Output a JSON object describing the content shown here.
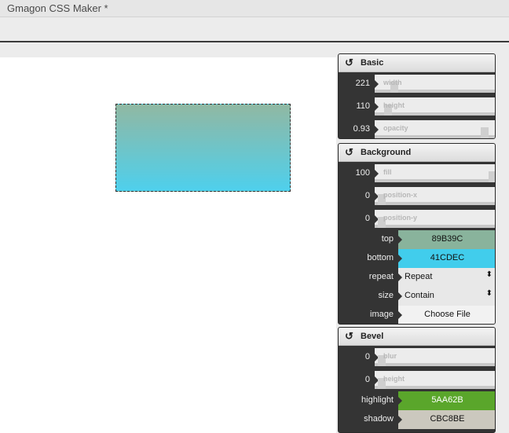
{
  "window": {
    "title": "Gmagon CSS Maker *"
  },
  "preview": {
    "top_color": "#89B39C",
    "bottom_color": "#41CDEC"
  },
  "basic": {
    "title": "Basic",
    "width": {
      "value": "221",
      "label": "width",
      "level": 0.11
    },
    "height": {
      "value": "110",
      "label": "height",
      "level": 0.06
    },
    "opacity": {
      "value": "0.93",
      "label": "opacity",
      "level": 0.93
    }
  },
  "background": {
    "title": "Background",
    "fill": {
      "value": "100",
      "label": "fill",
      "level": 1.0
    },
    "position_x": {
      "value": "0",
      "label": "position-x",
      "level": 0
    },
    "position_y": {
      "value": "0",
      "label": "position-y",
      "level": 0
    },
    "top": {
      "label": "top",
      "value": "89B39C",
      "color": "#89B39C"
    },
    "bottom": {
      "label": "bottom",
      "value": "41CDEC",
      "color": "#41CDEC"
    },
    "repeat": {
      "label": "repeat",
      "value": "Repeat"
    },
    "size": {
      "label": "size",
      "value": "Contain"
    },
    "image": {
      "label": "image",
      "value": "Choose File"
    }
  },
  "bevel": {
    "title": "Bevel",
    "blur": {
      "value": "0",
      "label": "blur",
      "level": 0
    },
    "height": {
      "value": "0",
      "label": "height",
      "level": 0
    },
    "highlight": {
      "label": "highlight",
      "value": "5AA62B",
      "color": "#5AA62B"
    },
    "shadow": {
      "label": "shadow",
      "value": "CBC8BE",
      "color": "#CBC8BE"
    }
  },
  "icons": {
    "reset": "reset-icon",
    "select_arrows": "select-arrows-icon"
  }
}
